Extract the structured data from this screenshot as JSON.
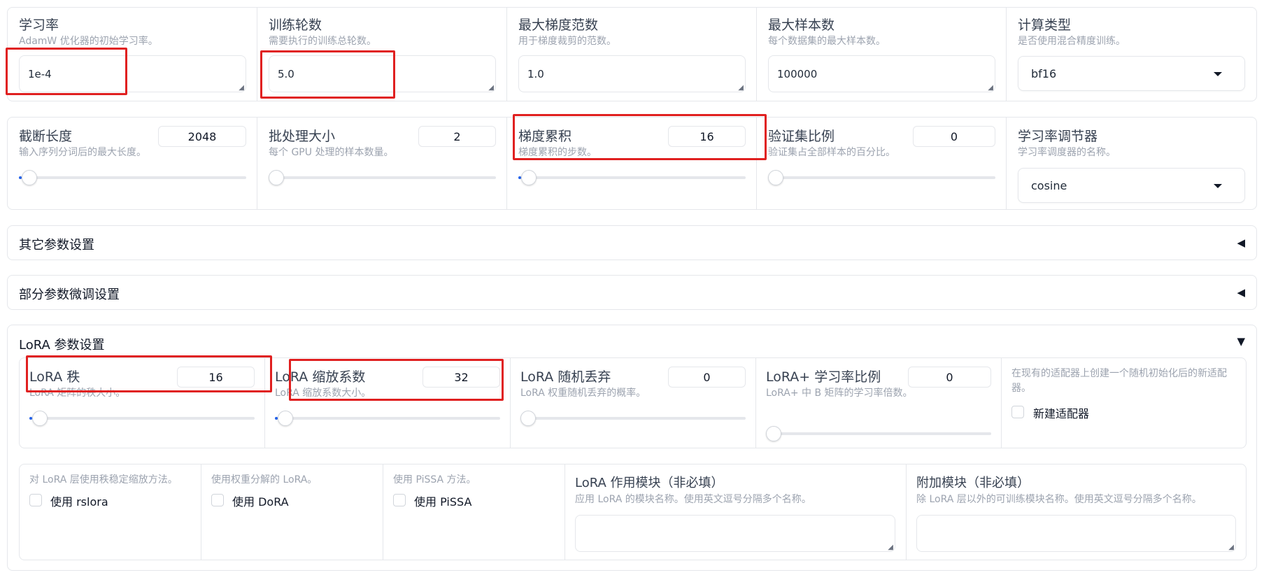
{
  "row1": [
    {
      "label": "学习率",
      "desc": "AdamW 优化器的初始学习率。",
      "value": "1e-4"
    },
    {
      "label": "训练轮数",
      "desc": "需要执行的训练总轮数。",
      "value": "5.0"
    },
    {
      "label": "最大梯度范数",
      "desc": "用于梯度裁剪的范数。",
      "value": "1.0"
    },
    {
      "label": "最大样本数",
      "desc": "每个数据集的最大样本数。",
      "value": "100000"
    },
    {
      "label": "计算类型",
      "desc": "是否使用混合精度训练。",
      "value": "bf16"
    }
  ],
  "row2": [
    {
      "label": "截断长度",
      "desc": "输入序列分词后的最大长度。",
      "value": "2048",
      "fraction": 0.01
    },
    {
      "label": "批处理大小",
      "desc": "每个 GPU 处理的样本数量。",
      "value": "2",
      "fraction": 0.0
    },
    {
      "label": "梯度累积",
      "desc": "梯度累积的步数。",
      "value": "16",
      "fraction": 0.01
    },
    {
      "label": "验证集比例",
      "desc": "验证集占全部样本的百分比。",
      "value": "0",
      "fraction": 0.0
    },
    {
      "label": "学习率调节器",
      "desc": "学习率调度器的名称。",
      "value": "cosine"
    }
  ],
  "accordions": {
    "other": {
      "title": "其它参数设置",
      "icon": "◀"
    },
    "partial": {
      "title": "部分参数微调设置",
      "icon": "◀"
    },
    "lora": {
      "title": "LoRA 参数设置",
      "icon": "▼"
    }
  },
  "lora_row1": [
    {
      "label": "LoRA 秩",
      "desc": "LoRA 矩阵的秩大小。",
      "value": "16",
      "fraction": 0.01
    },
    {
      "label": "LoRA 缩放系数",
      "desc": "LoRA 缩放系数大小。",
      "value": "32",
      "fraction": 0.01
    },
    {
      "label": "LoRA 随机丢弃",
      "desc": "LoRA 权重随机丢弃的概率。",
      "value": "0",
      "fraction": 0.0
    },
    {
      "label": "LoRA+ 学习率比例",
      "desc": "LoRA+ 中 B 矩阵的学习率倍数。",
      "value": "0",
      "fraction": 0.0
    }
  ],
  "new_adapter": {
    "desc": "在现有的适配器上创建一个随机初始化后的新适配器。",
    "label": "新建适配器"
  },
  "lora_row2": [
    {
      "desc": "对 LoRA 层使用秩稳定缩放方法。",
      "label": "使用 rslora"
    },
    {
      "desc": "使用权重分解的 LoRA。",
      "label": "使用 DoRA"
    },
    {
      "desc": "使用 PiSSA 方法。",
      "label": "使用 PiSSA"
    }
  ],
  "lora_target": {
    "label": "LoRA 作用模块（非必填）",
    "desc": "应用 LoRA 的模块名称。使用英文逗号分隔多个名称。",
    "value": ""
  },
  "additional_target": {
    "label": "附加模块（非必填）",
    "desc": "除 LoRA 层以外的可训练模块名称。使用英文逗号分隔多个名称。",
    "value": ""
  },
  "colors": {
    "highlight": "#e02020",
    "accent": "#2563eb"
  }
}
